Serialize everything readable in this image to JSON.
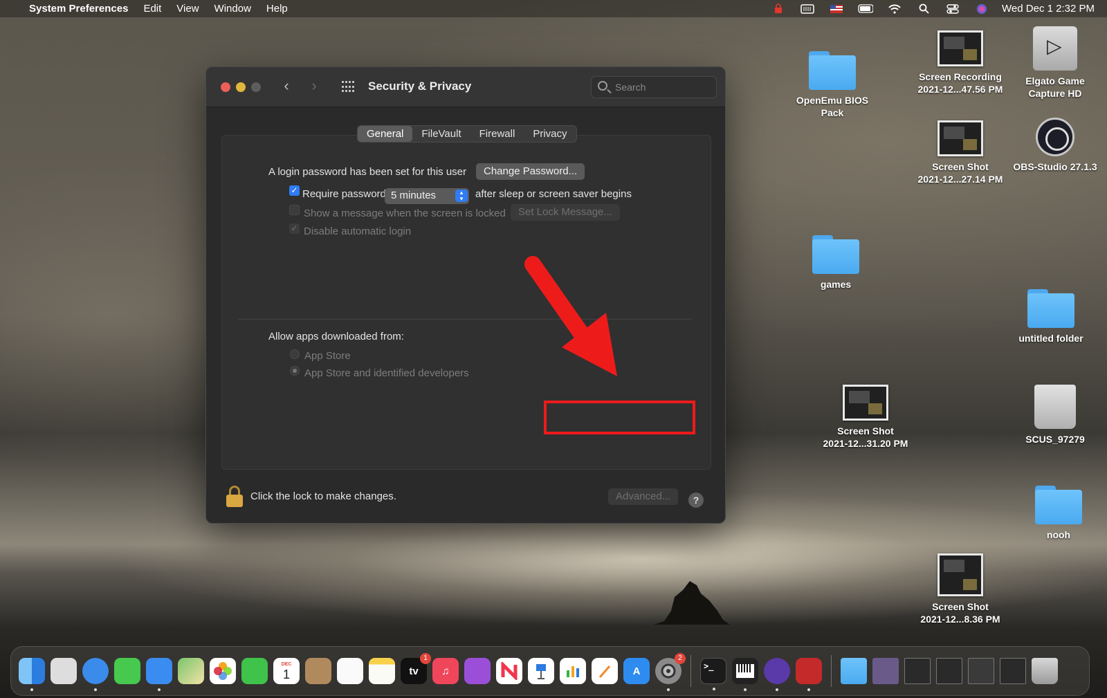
{
  "menubar": {
    "app_name": "System Preferences",
    "menus": [
      "Edit",
      "View",
      "Window",
      "Help"
    ],
    "clock": "Wed Dec 1  2:32 PM",
    "status_icons": [
      "lock-icon",
      "memory-icon",
      "flag-us-icon",
      "battery-icon",
      "wifi-icon",
      "spotlight-icon",
      "control-center-icon",
      "siri-icon"
    ]
  },
  "window": {
    "title": "Security & Privacy",
    "search_placeholder": "Search",
    "tabs": [
      "General",
      "FileVault",
      "Firewall",
      "Privacy"
    ],
    "active_tab": "General",
    "general": {
      "login_password_text": "A login password has been set for this user",
      "change_password_button": "Change Password...",
      "require_password_label": "Require password",
      "require_password_checked": true,
      "require_password_delay": "5 minutes",
      "after_sleep_text": "after sleep or screen saver begins",
      "show_message_label": "Show a message when the screen is locked",
      "show_message_checked": false,
      "set_lock_message_button": "Set Lock Message...",
      "disable_autologin_label": "Disable automatic login",
      "disable_autologin_checked": true,
      "allow_apps_heading": "Allow apps downloaded from:",
      "allow_options": [
        "App Store",
        "App Store and identified developers"
      ],
      "allow_selected": "App Store and identified developers"
    },
    "footer": {
      "lock_text": "Click the lock to make changes.",
      "advanced_button": "Advanced...",
      "help_button": "?"
    }
  },
  "annotation": {
    "color": "#ee1b1b"
  },
  "desktop_icons": [
    {
      "name": "OpenEmu BIOS\nPack",
      "type": "folder"
    },
    {
      "name": "Screen Recording\n2021-12...47.56 PM",
      "type": "screenshot"
    },
    {
      "name": "Elgato Game\nCapture HD",
      "type": "app-drive"
    },
    {
      "name": "Screen Shot\n2021-12...27.14 PM",
      "type": "screenshot"
    },
    {
      "name": "OBS-Studio 27.1.3",
      "type": "app-obs"
    },
    {
      "name": "games",
      "type": "folder"
    },
    {
      "name": "untitled folder",
      "type": "folder"
    },
    {
      "name": "Screen Shot\n2021-12...31.20 PM",
      "type": "screenshot"
    },
    {
      "name": "SCUS_97279",
      "type": "disc"
    },
    {
      "name": "nooh",
      "type": "folder"
    },
    {
      "name": "Screen Shot\n2021-12...8.36 PM",
      "type": "screenshot"
    }
  ],
  "dock": {
    "calendar_month": "DEC",
    "calendar_day": "1",
    "tv_label": "tv",
    "tv_badge": "1",
    "sysprefs_badge": "2"
  }
}
